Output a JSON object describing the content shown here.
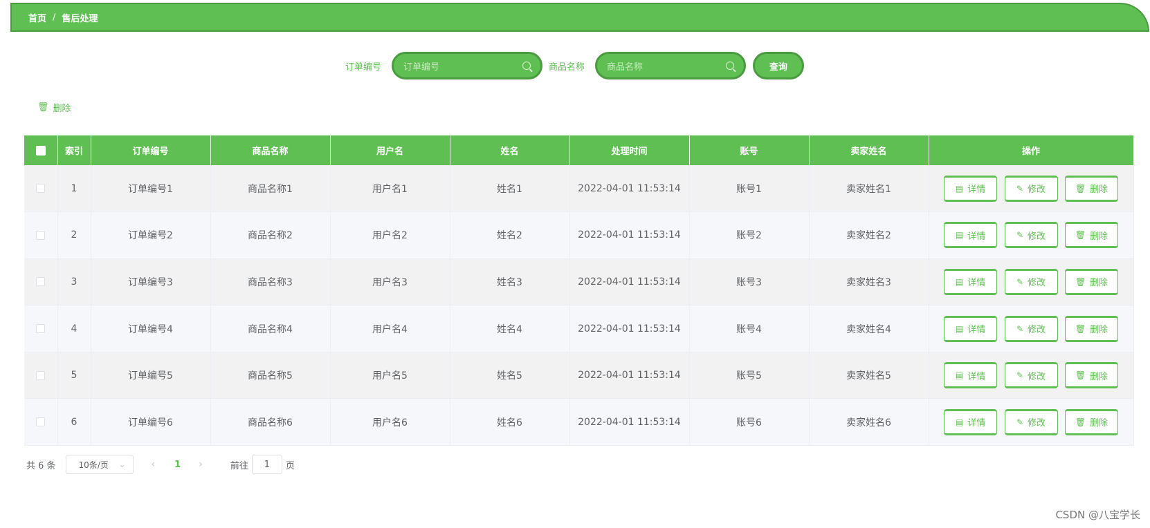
{
  "breadcrumb": {
    "home": "首页",
    "separator": "/",
    "current": "售后处理"
  },
  "search": {
    "order_label": "订单编号",
    "order_placeholder": "订单编号",
    "product_label": "商品名称",
    "product_placeholder": "商品名称",
    "query_button": "查询"
  },
  "toolbar": {
    "delete_label": "删除"
  },
  "table": {
    "headers": [
      "索引",
      "订单编号",
      "商品名称",
      "用户名",
      "姓名",
      "处理时间",
      "账号",
      "卖家姓名",
      "操作"
    ],
    "rows": [
      {
        "index": "1",
        "order_no": "订单编号1",
        "product": "商品名称1",
        "username": "用户名1",
        "name": "姓名1",
        "time": "2022-04-01 11:53:14",
        "account": "账号1",
        "seller": "卖家姓名1"
      },
      {
        "index": "2",
        "order_no": "订单编号2",
        "product": "商品名称2",
        "username": "用户名2",
        "name": "姓名2",
        "time": "2022-04-01 11:53:14",
        "account": "账号2",
        "seller": "卖家姓名2"
      },
      {
        "index": "3",
        "order_no": "订单编号3",
        "product": "商品名称3",
        "username": "用户名3",
        "name": "姓名3",
        "time": "2022-04-01 11:53:14",
        "account": "账号3",
        "seller": "卖家姓名3"
      },
      {
        "index": "4",
        "order_no": "订单编号4",
        "product": "商品名称4",
        "username": "用户名4",
        "name": "姓名4",
        "time": "2022-04-01 11:53:14",
        "account": "账号4",
        "seller": "卖家姓名4"
      },
      {
        "index": "5",
        "order_no": "订单编号5",
        "product": "商品名称5",
        "username": "用户名5",
        "name": "姓名5",
        "time": "2022-04-01 11:53:14",
        "account": "账号5",
        "seller": "卖家姓名5"
      },
      {
        "index": "6",
        "order_no": "订单编号6",
        "product": "商品名称6",
        "username": "用户名6",
        "name": "姓名6",
        "time": "2022-04-01 11:53:14",
        "account": "账号6",
        "seller": "卖家姓名6"
      }
    ],
    "actions": {
      "detail": "详情",
      "edit": "修改",
      "delete": "删除"
    }
  },
  "pagination": {
    "total": "共 6 条",
    "page_size": "10条/页",
    "current_page": "1",
    "goto_prefix": "前往",
    "goto_value": "1",
    "goto_suffix": "页"
  },
  "watermark": "CSDN @八宝学长",
  "colors": {
    "accent": "#5fbf52",
    "accent_dark": "#4a9a40"
  }
}
